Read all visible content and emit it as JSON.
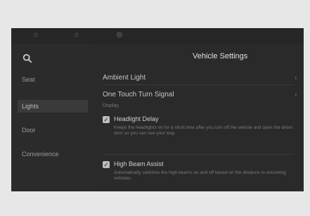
{
  "page": {
    "title": "Vehicle Settings",
    "section_label": "Display"
  },
  "topbar": {
    "icons": [
      "car-icon",
      "home-icon",
      "steering-wheel-icon"
    ]
  },
  "sidebar": {
    "items": [
      {
        "label": "Seat"
      },
      {
        "label": "Lights"
      },
      {
        "label": "Door"
      },
      {
        "label": "Convenience"
      }
    ]
  },
  "settings": {
    "rows": [
      {
        "label": "Ambient Light"
      },
      {
        "label": "One Touch Turn Signal"
      }
    ],
    "toggles": [
      {
        "title": "Headlight Delay",
        "checked": true,
        "description": "Keeps the headlights on for a short time after you turn off the vehicle and open the driver door so you can see your way."
      },
      {
        "title": "High Beam Assist",
        "checked": true,
        "description": "Automatically switches the high beams on and off based on the distance to oncoming vehicles."
      }
    ]
  }
}
